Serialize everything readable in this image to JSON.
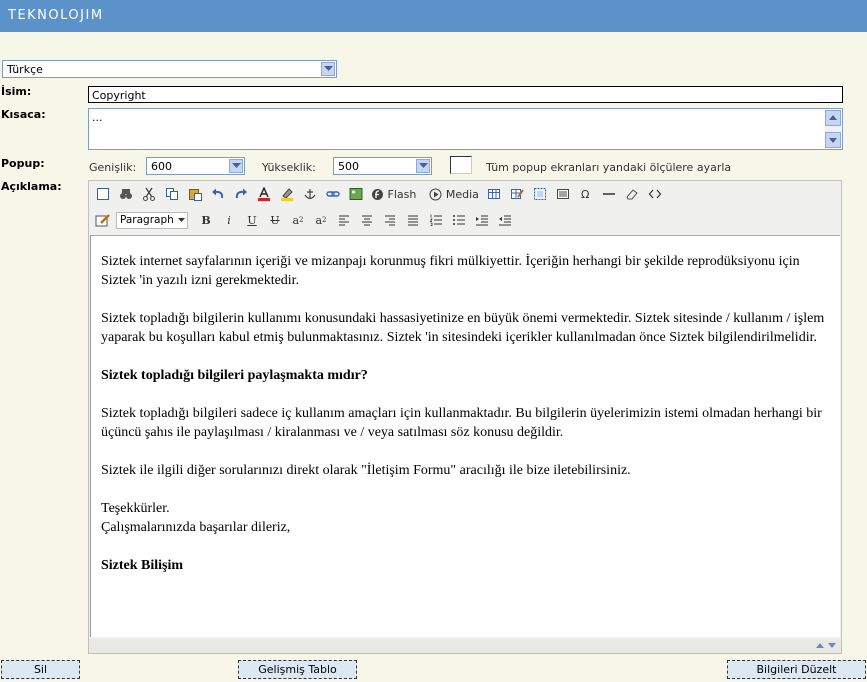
{
  "app": {
    "title": "TEKNOLOJIM"
  },
  "language": {
    "selected": "Türkçe"
  },
  "labels": {
    "name": "İsim:",
    "short": "Kısaca:",
    "popup": "Popup:",
    "description": "Açıklama:"
  },
  "fields": {
    "name_value": "Copyright",
    "short_value": "..."
  },
  "popup": {
    "width_label": "Genişlik:",
    "width_value": "600",
    "height_label": "Yükseklik:",
    "height_value": "500",
    "apply_all_label": "Tüm popup ekranları yandaki ölçülere ayarla"
  },
  "toolbar": {
    "flash_label": "Flash",
    "media_label": "Media",
    "format_value": "Paragraph"
  },
  "content": {
    "p1": "Siztek internet sayfalarının içeriği ve mizanpajı korunmuş fikri mülkiyettir. İçeriğin herhangi bir şekilde reprodüksiyonu için Siztek 'in yazılı izni gerekmektedir.",
    "p2": "Siztek topladığı bilgilerin kullanımı konusundaki hassasiyetinize en büyük önemi vermektedir. Siztek  sitesinde / kullanım / işlem yaparak bu koşulları kabul etmiş bulunmaktasınız. Siztek 'in sitesindeki içerikler kullanılmadan önce Siztek bilgilendirilmelidir.",
    "heading": "Siztek  topladığı bilgileri paylaşmakta mıdır?",
    "p3": "Siztek topladığı bilgileri sadece iç kullanım amaçları için kullanmaktadır. Bu bilgilerin üyelerimizin istemi olmadan herhangi bir üçüncü şahıs ile paylaşılması / kiralanması ve / veya satılması söz konusu değildir.",
    "p4": "Siztek ile ilgili diğer sorularınızı direkt olarak \"İletişim Formu\" aracılığı ile bize iletebilirsiniz.",
    "thanks": "Teşekkürler.",
    "wishes": "Çalışmalarınızda başarılar dileriz,",
    "signature": "Siztek Bilişim"
  },
  "buttons": {
    "delete": "Sil",
    "advanced_table": "Gelişmiş Tablo",
    "update": "Bilgileri Düzelt"
  },
  "colors": {
    "header": "#5b92c9",
    "background": "#f7f7e9",
    "button": "#dce8f2"
  }
}
